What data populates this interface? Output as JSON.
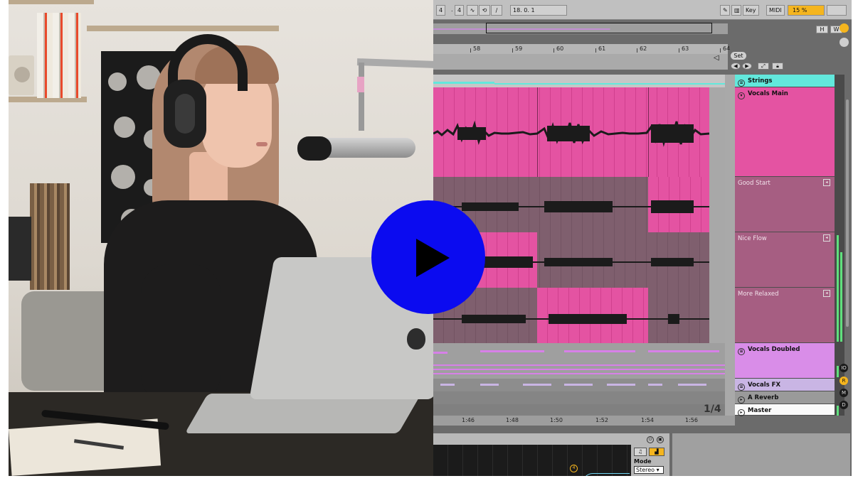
{
  "daw": {
    "transport": {
      "signature_num": "4",
      "signature_den": "4",
      "position": "18.  0.  1"
    },
    "toolbar": {
      "key_label": "Key",
      "midi_label": "MIDI",
      "zoom": "15 %",
      "hw_h": "H",
      "hw_w": "W"
    },
    "ruler_bars": [
      "58",
      "59",
      "60",
      "61",
      "62",
      "63",
      "64"
    ],
    "set_label": "Set",
    "tracks": [
      {
        "name": "Strings"
      },
      {
        "name": "Vocals Main"
      },
      {
        "name": "Good Start"
      },
      {
        "name": "Nice Flow"
      },
      {
        "name": "More Relaxed"
      },
      {
        "name": "Vocals Doubled"
      },
      {
        "name": "Vocals FX"
      },
      {
        "name": "A Reverb"
      },
      {
        "name": "Master"
      }
    ],
    "time_ruler": [
      "1:46",
      "1:48",
      "1:50",
      "1:52",
      "1:54",
      "1:56"
    ],
    "page_indicator": "1/4",
    "side_buttons": [
      "IO",
      "R",
      "M",
      "D"
    ],
    "device": {
      "mode_label": "Mode",
      "mode_value": "Stereo ▾"
    },
    "colors": {
      "clip_pink": "#e453a2",
      "track_teal": "#62e8dc",
      "track_purple": "#d98de8",
      "track_lavender": "#c9b5e4",
      "accent_yellow": "#f5b51e",
      "play_blue": "#0b0bf0"
    }
  },
  "video": {
    "play_icon": "play-icon"
  }
}
